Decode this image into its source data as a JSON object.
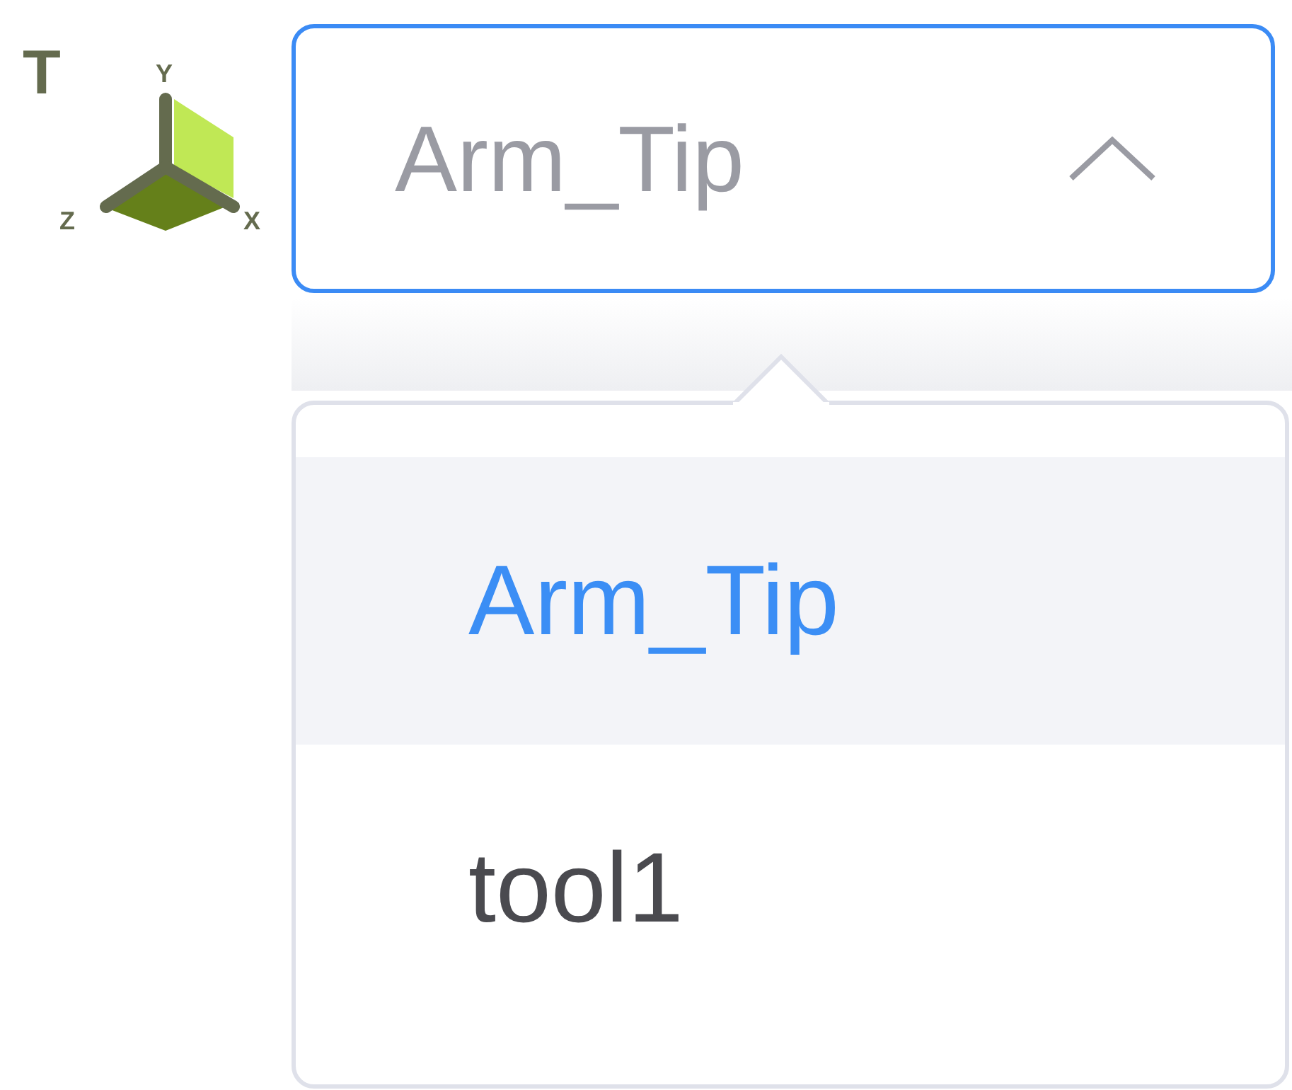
{
  "axis_icon": {
    "frame_label": "T",
    "axis_labels": [
      "Y",
      "Z",
      "X"
    ]
  },
  "select": {
    "value": "Arm_Tip",
    "expanded": true
  },
  "options": [
    {
      "label": "Arm_Tip",
      "selected": true
    },
    {
      "label": "tool1",
      "selected": false
    }
  ]
}
